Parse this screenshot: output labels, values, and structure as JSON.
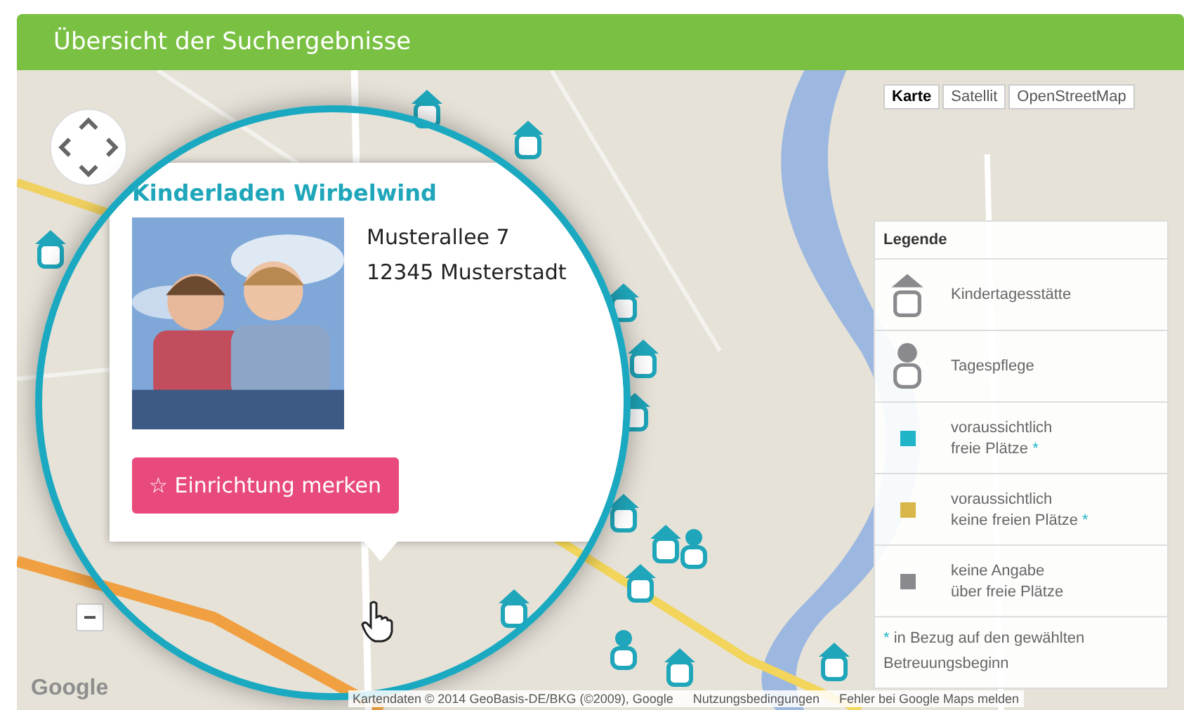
{
  "header": {
    "title": "Übersicht der Suchergebnisse"
  },
  "map_types": [
    {
      "label": "Karte",
      "selected": true
    },
    {
      "label": "Satellit",
      "selected": false
    },
    {
      "label": "OpenStreetMap",
      "selected": false
    }
  ],
  "popup": {
    "title": "Kinderladen Wirbelwind",
    "photo": {
      "kind": "picture"
    },
    "address": [
      "Musterallee 7",
      "12345 Musterstadt"
    ],
    "button": {
      "icon": "☆",
      "label": "Einrichtung merken"
    }
  },
  "legend": {
    "title": "Legende",
    "items": [
      {
        "kind": "house",
        "lines": [
          "Kindertagesstätte"
        ]
      },
      {
        "kind": "person",
        "lines": [
          "Tagespflege"
        ]
      },
      {
        "kind": "swatch",
        "color": "#1fb4c8",
        "lines": [
          "voraussichtlich",
          "freie Plätze"
        ],
        "note_mark": "*"
      },
      {
        "kind": "swatch",
        "color": "#d9b64a",
        "lines": [
          "voraussichtlich",
          "keine freien Plätze"
        ],
        "note_mark": "*"
      },
      {
        "kind": "swatch",
        "color": "#8a8a8e",
        "lines": [
          "keine Angabe",
          "über freie Plätze"
        ]
      }
    ],
    "footnote": {
      "mark": "*",
      "text": "in Bezug auf den gewählten Betreuungsbeginn"
    }
  },
  "attribution": {
    "logo": "Google",
    "data": "Kartendaten © 2014 GeoBasis-DE/BKG (©2009), Google",
    "terms": "Nutzungsbedingungen",
    "report": "Fehler bei Google Maps melden"
  }
}
